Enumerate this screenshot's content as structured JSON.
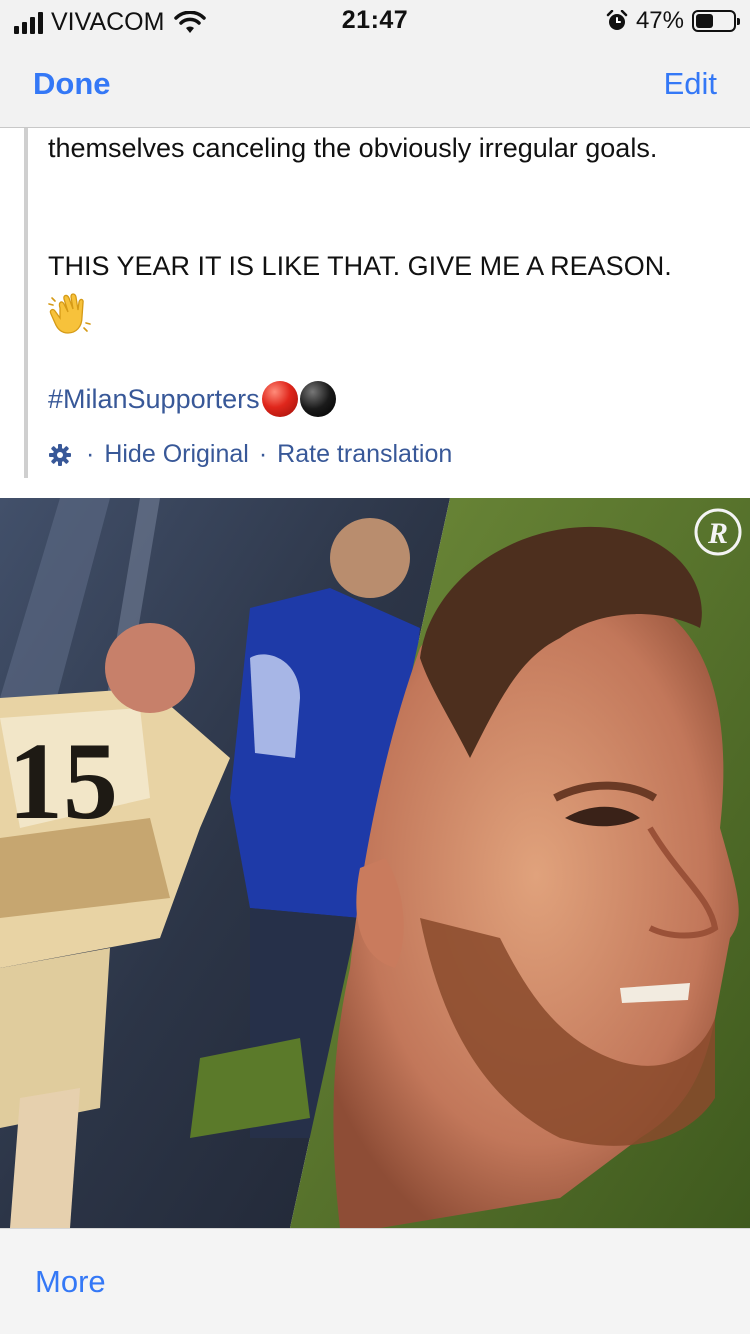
{
  "status_bar": {
    "carrier": "VIVACOM",
    "time": "21:47",
    "battery_percent": "47%",
    "battery_level": 0.47
  },
  "nav": {
    "done_label": "Done",
    "edit_label": "Edit"
  },
  "post": {
    "paragraph_1": "themselves canceling the obviously irregular goals.",
    "paragraph_2": "THIS YEAR IT IS LIKE THAT. GIVE ME A REASON.",
    "emoji": "waving-hand",
    "hashtag": "#MilanSupporters",
    "hashtag_emojis": [
      "red-circle",
      "black-circle"
    ],
    "translation": {
      "separator": "·",
      "hide_original": "Hide Original",
      "rate_translation": "Rate translation"
    }
  },
  "photo": {
    "watermark": "R",
    "shirt_number": "15"
  },
  "bottom_bar": {
    "more_label": "More"
  },
  "colors": {
    "ios_blue": "#3478f6",
    "link_blue": "#385898",
    "bar_bg": "#f2f2f2"
  }
}
